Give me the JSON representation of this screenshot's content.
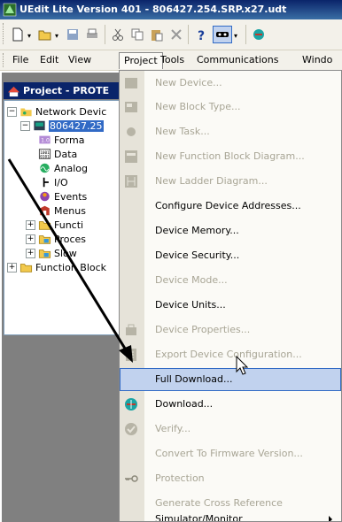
{
  "window": {
    "title": "UEdit Lite Version 401 - 806427.254.SRP.x27.udt"
  },
  "toolbar": {
    "icons": [
      "new-icon",
      "open-icon",
      "save-icon",
      "print-icon",
      "cut-icon",
      "copy-icon",
      "paste-icon",
      "delete-icon",
      "help-icon",
      "connect-icon",
      "device-icon"
    ]
  },
  "menubar": {
    "items": [
      "File",
      "Edit",
      "View",
      "Project",
      "Tools",
      "Communications",
      "Windo"
    ]
  },
  "project_panel": {
    "title": "Project - PROTE",
    "tree": [
      {
        "label": "Network Devic",
        "level": 0,
        "expander": "−"
      },
      {
        "label": "806427.25",
        "level": 1,
        "expander": "−",
        "selected": true
      },
      {
        "label": "Forma",
        "level": 2
      },
      {
        "label": "Data",
        "level": 2
      },
      {
        "label": "Analog",
        "level": 2
      },
      {
        "label": "I/O",
        "level": 2
      },
      {
        "label": "Events",
        "level": 2
      },
      {
        "label": "Menus",
        "level": 2
      },
      {
        "label": "Functi",
        "level": 2,
        "expander": "+"
      },
      {
        "label": "Proces",
        "level": 2,
        "expander": "+"
      },
      {
        "label": "Slow",
        "level": 2,
        "expander": "+"
      },
      {
        "label": "Function Block",
        "level": 0,
        "expander": "+"
      }
    ]
  },
  "project_menu": {
    "items": [
      {
        "label": "New Device...",
        "enabled": false,
        "icon": "new-device-icon"
      },
      {
        "label": "New Block Type...",
        "enabled": false,
        "icon": "new-block-type-icon"
      },
      {
        "label": "New Task...",
        "enabled": false,
        "icon": "new-task-icon"
      },
      {
        "label": "New Function Block Diagram...",
        "enabled": false,
        "icon": "function-block-diagram-icon"
      },
      {
        "label": "New Ladder Diagram...",
        "enabled": false,
        "icon": "ladder-diagram-icon"
      },
      {
        "label": "Configure Device Addresses...",
        "enabled": true
      },
      {
        "label": "Device Memory...",
        "enabled": true
      },
      {
        "label": "Device Security...",
        "enabled": true
      },
      {
        "label": "Device Mode...",
        "enabled": false
      },
      {
        "label": "Device Units...",
        "enabled": true
      },
      {
        "label": "Device Properties...",
        "enabled": false,
        "icon": "device-properties-icon"
      },
      {
        "label": "Export Device Configuration...",
        "enabled": false,
        "icon": "export-config-icon"
      },
      {
        "label": "Full Download...",
        "enabled": true,
        "highlighted": true
      },
      {
        "label": "Download...",
        "enabled": true,
        "icon": "download-icon"
      },
      {
        "label": "Verify...",
        "enabled": false,
        "icon": "verify-icon"
      },
      {
        "label": "Convert To Firmware Version...",
        "enabled": false
      },
      {
        "label": "Protection",
        "enabled": false,
        "icon": "key-icon"
      },
      {
        "label": "Generate Cross Reference",
        "enabled": false
      },
      {
        "label": "Simulator/Monitor",
        "enabled": true,
        "submenu": true
      }
    ]
  },
  "colors": {
    "titlebar": "#0a246a",
    "highlight": "#c1d2ee",
    "highlight_border": "#316ac5",
    "disabled_text": "#a8a595"
  }
}
